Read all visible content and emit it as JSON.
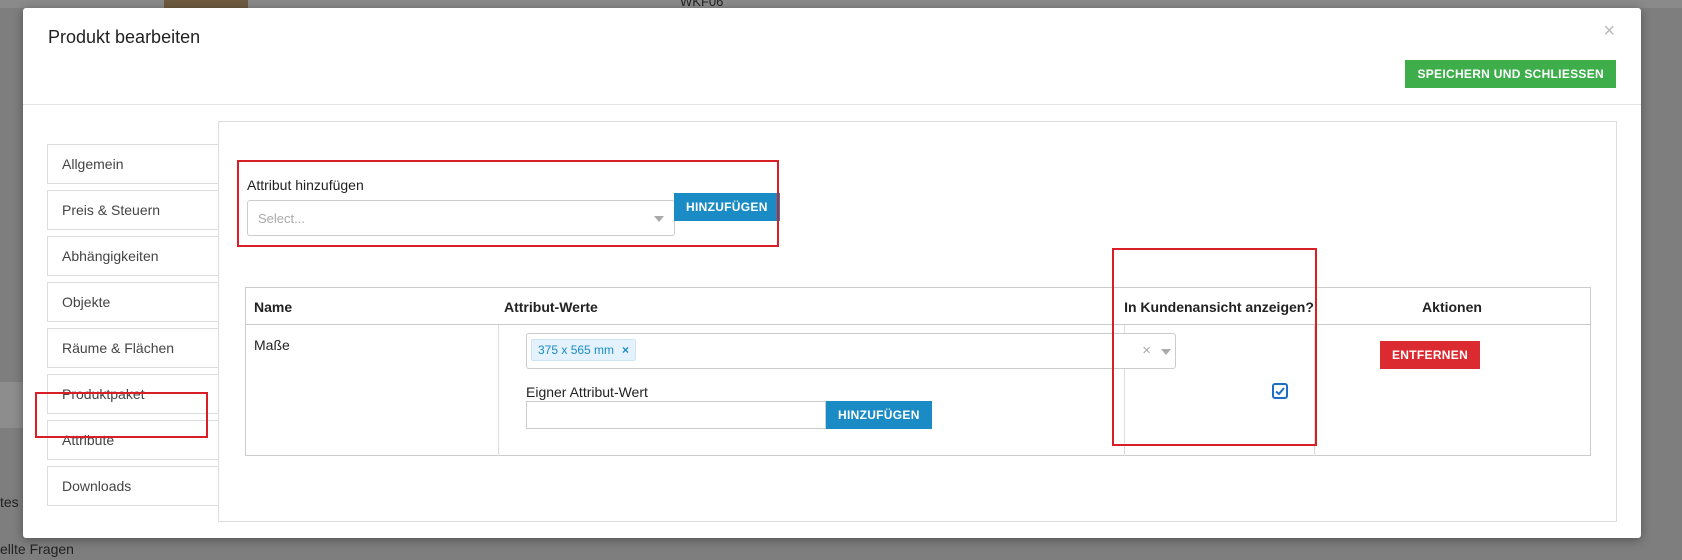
{
  "background": {
    "code": "WKF06",
    "partial_text_1": "tes",
    "partial_text_2": "ellte Fragen"
  },
  "modal": {
    "title": "Produkt bearbeiten",
    "close_symbol": "×",
    "save_label": "SPEICHERN UND SCHLIESSEN"
  },
  "tabs": [
    {
      "label": "Allgemein"
    },
    {
      "label": "Preis & Steuern"
    },
    {
      "label": "Abhängigkeiten"
    },
    {
      "label": "Objekte"
    },
    {
      "label": "Räume & Flächen"
    },
    {
      "label": "Produktpaket"
    },
    {
      "label": "Attribute",
      "active": true
    },
    {
      "label": "Downloads"
    }
  ],
  "add_attribute": {
    "label": "Attribut hinzufügen",
    "placeholder": "Select...",
    "button_label": "HINZUFÜGEN"
  },
  "table": {
    "headers": {
      "name": "Name",
      "values": "Attribut-Werte",
      "customer_view": "In Kundenansicht anzeigen?",
      "actions": "Aktionen"
    },
    "rows": [
      {
        "name": "Maße",
        "tags": [
          "375 x 565 mm"
        ],
        "tag_remove_symbol": "×",
        "clear_symbol": "×",
        "own_value_label": "Eigner Attribut-Wert",
        "own_value_button": "HINZUFÜGEN",
        "customer_view_checked": true,
        "remove_label": "ENTFERNEN"
      }
    ]
  },
  "colors": {
    "save_button": "#3eae4b",
    "primary_button": "#1b8bc6",
    "danger_button": "#dc2a31",
    "highlight": "#d91f26"
  }
}
